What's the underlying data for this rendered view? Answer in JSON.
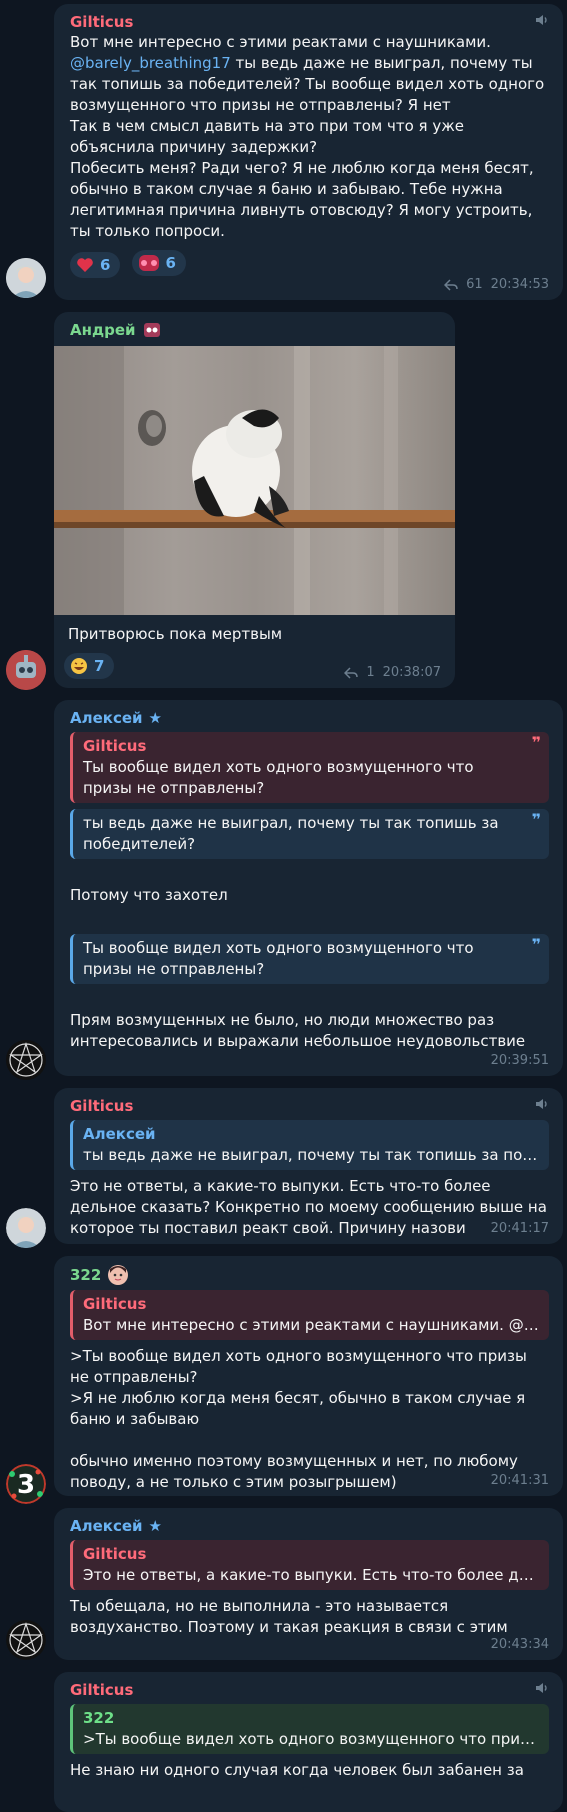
{
  "m1": {
    "author": "Gilticus",
    "author_color": "#ff6b7a",
    "mention": "@barely_breathing17",
    "text_before": "Вот мне интересно с этими реактами с наушниками.\n",
    "text_after": " ты ведь даже не выиграл, почему ты так топишь за победителей? Ты вообще видел хоть одного возмущенного что призы не отправлены? Я нет\nТак в чем смысл давить на это при том что я уже объяснила причину задержки?\nПобесить меня? Ради чего? Я не люблю когда меня бесят, обычно в таком случае я баню и забываю. Тебе нужна легитимная причина ливнуть отовсюду? Я могу устроить, ты только попроси.",
    "reaction1_count": "6",
    "reaction2_count": "6",
    "replies": "61",
    "time": "20:34:53"
  },
  "m2": {
    "author": "Андрей",
    "author_color": "#7bd88f",
    "caption": "Притворюсь пока мертвым",
    "reaction_count": "7",
    "replies": "1",
    "time": "20:38:07"
  },
  "m3": {
    "author": "Алексей",
    "q1_name": "Gilticus",
    "q1_text": "Ты вообще видел хоть одного возмущенного что призы не отправлены?",
    "q2_text": "ты ведь даже не выиграл, почему ты так топишь за победителей?",
    "text1": "Потому что захотел",
    "q3_text": "Ты вообще видел хоть одного возмущенного что призы не отправлены?",
    "text2": "Прям возмущенных не было, но люди множество раз интересовались и выражали небольшое неудовольствие",
    "time": "20:39:51"
  },
  "m4": {
    "author": "Gilticus",
    "q_name": "Алексей",
    "q_text": "ты ведь даже не выиграл, почему ты так топишь за побе...",
    "text": "Это не ответы, а какие-то выпуки. Есть что-то более дельное сказать? Конкретно по моему сообщению выше на которое ты поставил реакт свой. Причину назови",
    "time": "20:41:17"
  },
  "m5": {
    "author": "322",
    "author_color": "#7bd88f",
    "q_name": "Gilticus",
    "q_text": "Вот мне интересно с этими реактами с наушниками. @b...",
    "text": ">Ты вообще видел хоть одного возмущенного что призы не отправлены?\n>Я не люблю когда меня бесят, обычно в таком случае я баню и забываю\n\nобычно именно поэтому возмущенных и нет, по любому поводу, а не только с этим розыгрышем)",
    "time": "20:41:31",
    "avatar_digit": "3"
  },
  "m6": {
    "author": "Алексей",
    "q_name": "Gilticus",
    "q_text": "Это не ответы, а какие-то выпуки. Есть что-то более дель...",
    "text": "Ты обещала, но не выполнила - это называется воздуханство. Поэтому и такая реакция в связи с этим",
    "time": "20:43:34"
  },
  "m7": {
    "author": "Gilticus",
    "q_name": "322",
    "q_text": ">Ты вообще видел хоть одного возмущенного что приз...",
    "text": "Не знаю ни одного случая когда человек был забанен за"
  },
  "colors": {
    "bg": "#0e1621",
    "bubble": "#182533",
    "link": "#6ab3f3"
  }
}
